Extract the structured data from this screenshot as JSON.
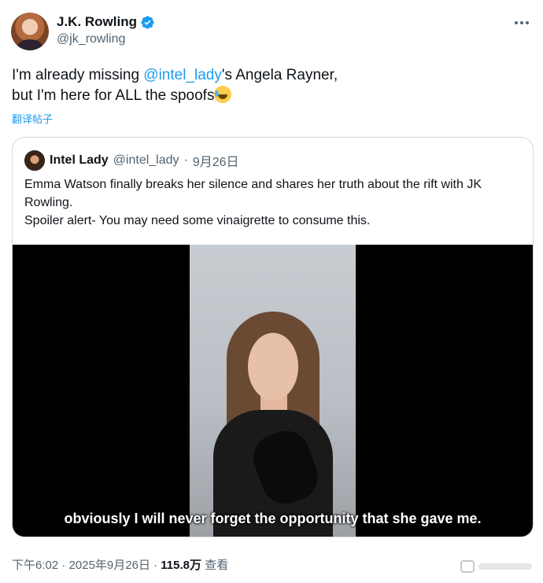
{
  "author": {
    "name": "J.K. Rowling",
    "handle": "@jk_rowling"
  },
  "tweet": {
    "line1_before": "I'm already missing ",
    "mention": "@intel_lady",
    "line1_after": "'s Angela Rayner,",
    "line2": "but I'm here for ALL the spoofs",
    "emoji": "rolling-on-floor-laughing-emoji",
    "translate_label": "翻译帖子"
  },
  "quote": {
    "name": "Intel Lady",
    "handle": "@intel_lady",
    "separator": "·",
    "date": "9月26日",
    "text_line1": "Emma Watson finally breaks her silence and shares her truth about the rift with JK Rowling.",
    "text_line2": "Spoiler alert- You may need some vinaigrette to consume this.",
    "video_subtitle": "obviously I will never forget the opportunity that she gave me."
  },
  "meta": {
    "time": "下午6:02",
    "sep1": "·",
    "date": "2025年9月26日",
    "sep2": "·",
    "views": "115.8万",
    "views_label": "查看"
  },
  "colors": {
    "accent": "#1d9bf0",
    "text": "#0f1419",
    "secondary": "#536471",
    "border": "#cfd9de"
  }
}
